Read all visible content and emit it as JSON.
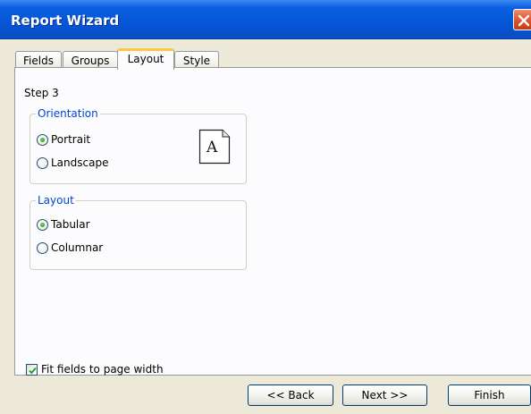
{
  "window": {
    "title": "Report Wizard"
  },
  "tabs": [
    {
      "label": "Fields",
      "active": false
    },
    {
      "label": "Groups",
      "active": false
    },
    {
      "label": "Layout",
      "active": true
    },
    {
      "label": "Style",
      "active": false
    }
  ],
  "step_label": "Step 3",
  "orientation": {
    "legend": "Orientation",
    "options": [
      {
        "label": "Portrait",
        "selected": true
      },
      {
        "label": "Landscape",
        "selected": false
      }
    ],
    "preview_letter": "A"
  },
  "layout_group": {
    "legend": "Layout",
    "options": [
      {
        "label": "Tabular",
        "selected": true
      },
      {
        "label": "Columnar",
        "selected": false
      }
    ]
  },
  "fit_fields": {
    "label": "Fit fields to page width",
    "checked": true
  },
  "buttons": {
    "back": "<< Back",
    "next": "Next >>",
    "finish": "Finish"
  },
  "colors": {
    "title_bar": "#0654d6",
    "legend_text": "#0046d5",
    "active_tab_accent": "#ffc83c",
    "radio_dot": "#29a61a",
    "close_button": "#e35a32"
  }
}
